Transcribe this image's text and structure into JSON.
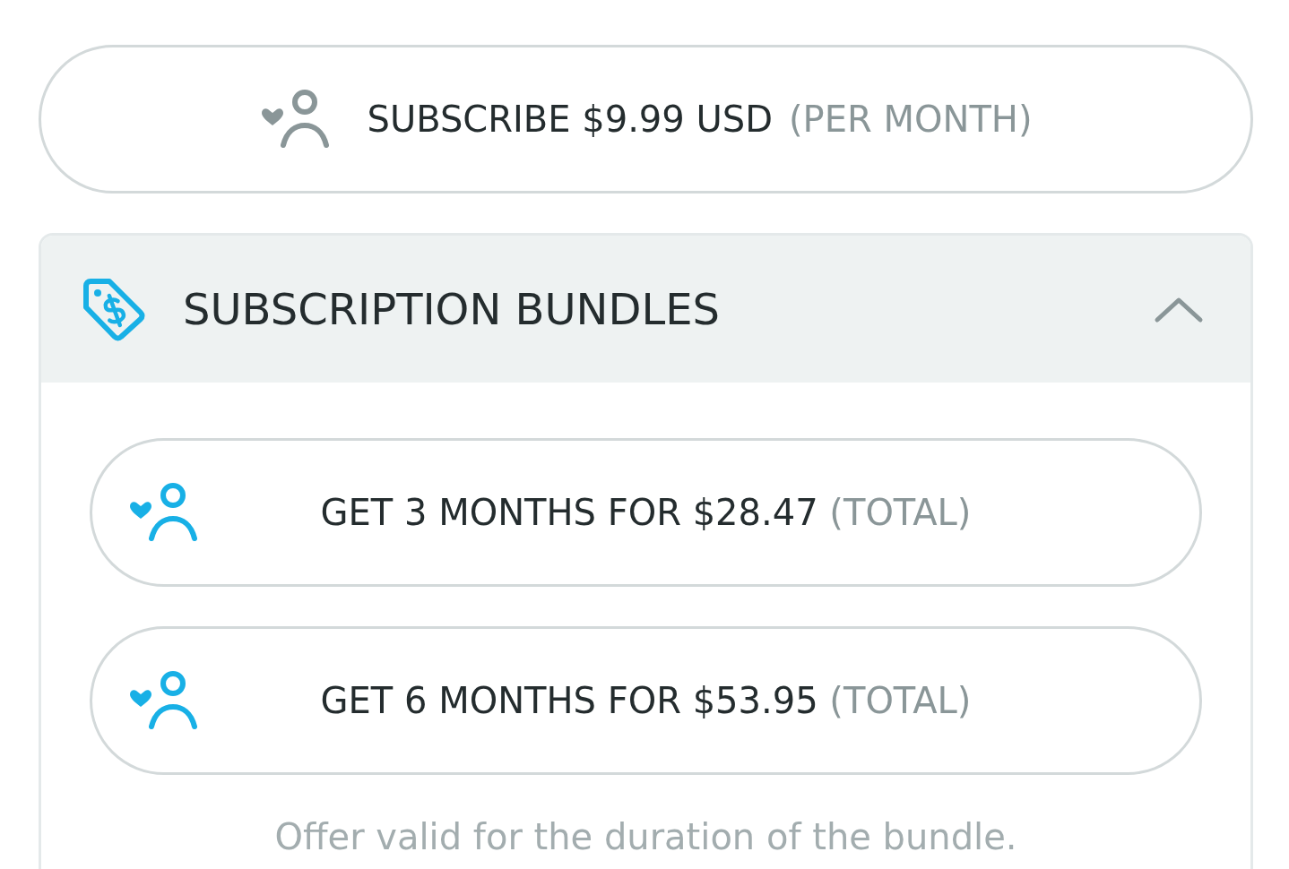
{
  "subscribe_button": {
    "label": "SUBSCRIBE $9.99 USD",
    "note": "(PER MONTH)"
  },
  "bundles": {
    "title": "SUBSCRIPTION BUNDLES",
    "expanded": true,
    "options": [
      {
        "label": "GET 3 MONTHS FOR $28.47",
        "note": "(TOTAL)"
      },
      {
        "label": "GET 6 MONTHS FOR $53.95",
        "note": "(TOTAL)"
      }
    ],
    "footnote": "Offer valid for the duration of the bundle."
  }
}
